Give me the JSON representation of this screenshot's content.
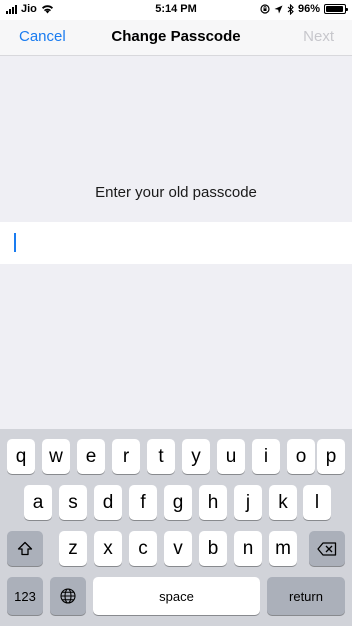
{
  "status_bar": {
    "carrier": "Jio",
    "time": "5:14 PM",
    "battery_percent": "96%",
    "battery_level": 0.96,
    "icons": [
      "signal-icon",
      "wifi-icon",
      "orientation-lock-icon",
      "location-icon",
      "bluetooth-icon",
      "battery-icon"
    ]
  },
  "nav": {
    "cancel_label": "Cancel",
    "title": "Change Passcode",
    "next_label": "Next"
  },
  "content": {
    "prompt": "Enter your old passcode"
  },
  "keyboard": {
    "row1": [
      "q",
      "w",
      "e",
      "r",
      "t",
      "y",
      "u",
      "i",
      "o",
      "p"
    ],
    "row2": [
      "a",
      "s",
      "d",
      "f",
      "g",
      "h",
      "j",
      "k",
      "l"
    ],
    "row3": [
      "z",
      "x",
      "c",
      "v",
      "b",
      "n",
      "m"
    ],
    "numbers_label": "123",
    "space_label": "space",
    "return_label": "return",
    "icons": [
      "shift-icon",
      "delete-icon",
      "globe-icon"
    ]
  },
  "colors": {
    "accent": "#1a7cf0",
    "disabled": "#c7c7cc",
    "keyboard_bg": "#d1d3d9",
    "dark_key": "#abb0ba"
  }
}
